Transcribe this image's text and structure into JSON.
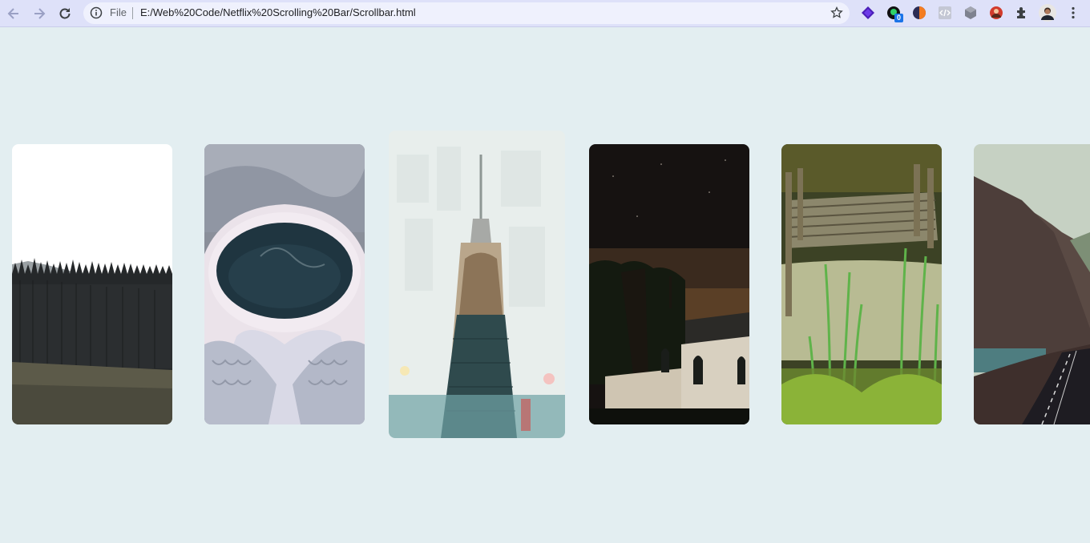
{
  "browser": {
    "omnibox": {
      "scheme_label": "File",
      "url": "E:/Web%20Code/Netflix%20Scrolling%20Bar/Scrollbar.html"
    },
    "extensions": [
      {
        "name": "purple-gem-extension-icon"
      },
      {
        "name": "green-extension-icon",
        "badge": "0"
      },
      {
        "name": "orange-circle-extension-icon"
      },
      {
        "name": "code-extension-icon"
      },
      {
        "name": "cube-extension-icon"
      },
      {
        "name": "red-avatar-extension-icon"
      },
      {
        "name": "puzzle-icon"
      },
      {
        "name": "profile-avatar"
      },
      {
        "name": "kebab-menu-icon"
      }
    ]
  },
  "gallery": {
    "cards": [
      {
        "name": "forest-card",
        "subject": "forest"
      },
      {
        "name": "coffee-card",
        "subject": "coffee"
      },
      {
        "name": "city-tower-card",
        "subject": "tower",
        "state": "hovered"
      },
      {
        "name": "church-night-card",
        "subject": "church"
      },
      {
        "name": "dock-lake-card",
        "subject": "dock"
      },
      {
        "name": "mountain-road-card",
        "subject": "mountain"
      }
    ]
  }
}
